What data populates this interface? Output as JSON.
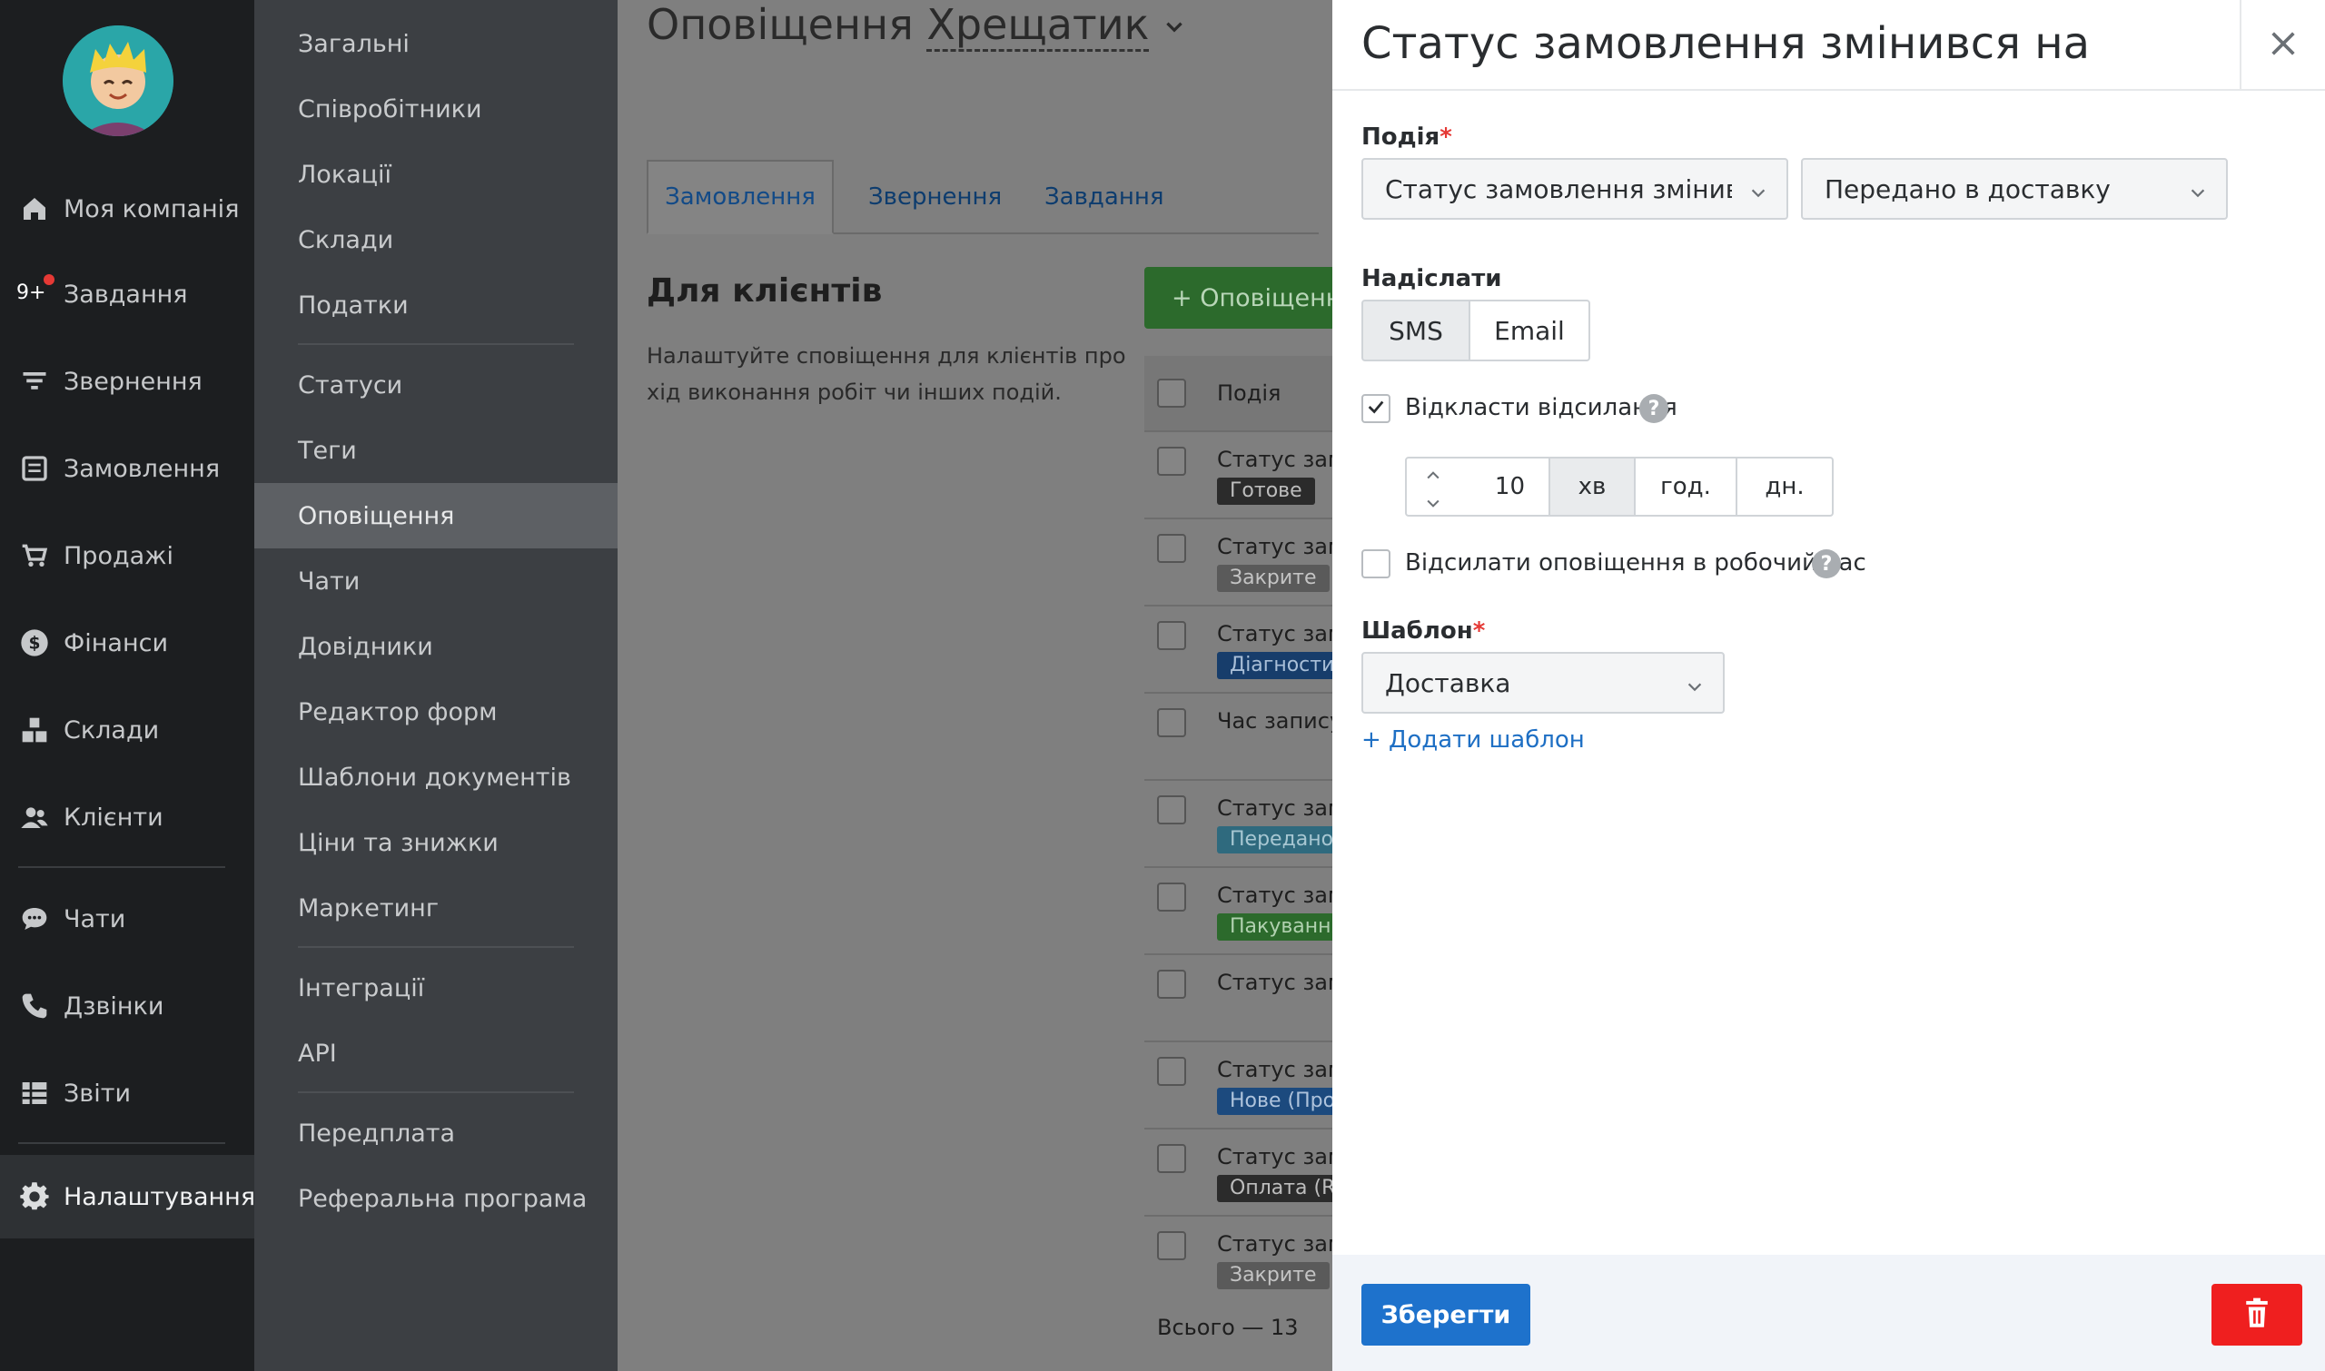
{
  "sidebar": {
    "items": [
      {
        "label": "Моя компанія",
        "icon": "home-icon"
      },
      {
        "label": "Завдання",
        "icon": "tasks-icon",
        "badge": "9+"
      },
      {
        "label": "Звернення",
        "icon": "funnel-icon"
      },
      {
        "label": "Замовлення",
        "icon": "orders-icon"
      },
      {
        "label": "Продажі",
        "icon": "cart-icon"
      },
      {
        "label": "Фінанси",
        "icon": "dollar-icon"
      },
      {
        "label": "Склади",
        "icon": "boxes-icon"
      },
      {
        "label": "Клієнти",
        "icon": "users-icon"
      },
      {
        "label": "Чати",
        "icon": "chat-icon"
      },
      {
        "label": "Дзвінки",
        "icon": "phone-icon"
      },
      {
        "label": "Звіти",
        "icon": "reports-icon"
      },
      {
        "label": "Налаштування",
        "icon": "gear-icon",
        "active": true
      }
    ]
  },
  "submenu": {
    "items": [
      "Загальні",
      "Співробітники",
      "Локації",
      "Склади",
      "Податки",
      "Статуси",
      "Теги",
      "Оповіщення",
      "Чати",
      "Довідники",
      "Редактор форм",
      "Шаблони документів",
      "Ціни та знижки",
      "Маркетинг",
      "Інтеграції",
      "API",
      "Передплата",
      "Реферальна програма"
    ],
    "active": "Оповіщення"
  },
  "main": {
    "title": "Оповіщення",
    "location": "Хрещатик",
    "tabs": [
      "Замовлення",
      "Звернення",
      "Завдання"
    ],
    "section_title": "Для клієнтів",
    "section_desc": "Налаштуйте сповіщення для клієнтів про хід виконання робіт чи інших подій.",
    "add_button": "+ Оповіщення",
    "column_header": "Подія",
    "rows": [
      {
        "text": "Статус замовлення змінився на",
        "tag": "Готове",
        "tag_bg": "#2b2b2b",
        "tag_fg": "#bdbdbd"
      },
      {
        "text": "Статус замовлення змінився на",
        "tag": "Закрите",
        "tag_bg": "#5a5a5a",
        "tag_fg": "#c4c4c4"
      },
      {
        "text": "Статус замовлення змінився на",
        "tag": "Діагностика",
        "tag_bg": "#173d6b",
        "tag_fg": "#a9bfd8"
      },
      {
        "text": "Час запису",
        "tag": "",
        "tag_bg": "",
        "tag_fg": ""
      },
      {
        "text": "Статус замовлення змінився на",
        "tag": "Передано в доставку",
        "tag_bg": "#2f6a7e",
        "tag_fg": "#a7c7d2"
      },
      {
        "text": "Статус замовлення змінився на",
        "tag": "Пакування",
        "tag_bg": "#2c6a2c",
        "tag_fg": "#b1d1b0"
      },
      {
        "text": "Статус замовлення змінився на",
        "tag": "",
        "tag_bg": "",
        "tag_fg": ""
      },
      {
        "text": "Статус замовлення змінився на",
        "tag": "Нове (Продаж)",
        "tag_bg": "#1c4a7e",
        "tag_fg": "#aec3dc"
      },
      {
        "text": "Статус замовлення змінився на",
        "tag": "Оплата (RO)",
        "tag_bg": "#2b2b2b",
        "tag_fg": "#bdbdbd"
      },
      {
        "text": "Статус замовлення змінився на",
        "tag": "Закрите",
        "tag_bg": "#5a5a5a",
        "tag_fg": "#c4c4c4"
      }
    ],
    "total": "Всього — 13"
  },
  "drawer": {
    "title": "Статус замовлення змінився на",
    "event_label": "Подія",
    "event_value": "Статус замовлення змінився на",
    "status_value": "Передано в доставку",
    "send_label": "Надіслати",
    "send_options": [
      "SMS",
      "Email"
    ],
    "send_selected": "SMS",
    "delay_label": "Відкласти відсилання",
    "delay_checked": true,
    "delay_value": "10",
    "delay_units": [
      "хв",
      "год.",
      "дн."
    ],
    "delay_unit_selected": "хв",
    "worktime_label": "Відсилати оповіщення в робочий час",
    "worktime_checked": false,
    "help_glyph": "?",
    "template_label": "Шаблон",
    "template_value": "Доставка",
    "add_template": "+ Додати шаблон",
    "save_label": "Зберегти"
  },
  "colors": {
    "accent": "#1e72cc",
    "danger": "#ef1f1f",
    "required": "#e53935",
    "link": "#1e6fc4"
  }
}
